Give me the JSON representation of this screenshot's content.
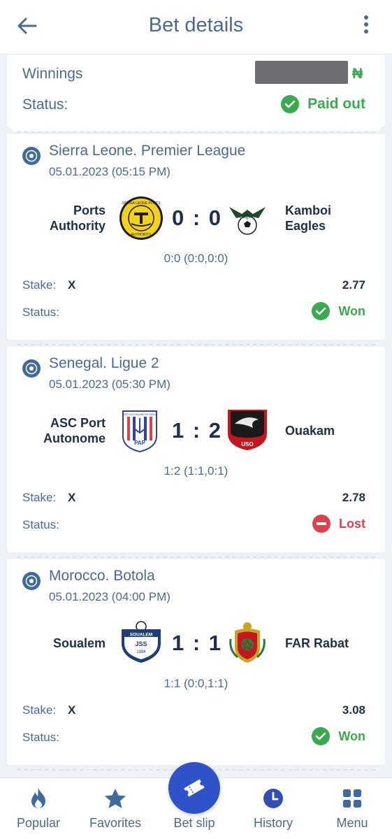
{
  "header": {
    "title": "Bet details"
  },
  "summary": {
    "winnings_label": "Winnings",
    "currency_symbol": "₦",
    "status_label": "Status:",
    "status_value": "Paid out"
  },
  "matches": [
    {
      "league": "Sierra Leone. Premier League",
      "date": "05.01.2023 (05:15 PM)",
      "home_line1": "Ports",
      "home_line2": "Authority",
      "away_line1": "Kamboi",
      "away_line2": "Eagles",
      "score": "0 : 0",
      "score_detail": "0:0 (0:0,0:0)",
      "stake_label": "Stake:",
      "stake_value": "X",
      "odds": "2.77",
      "status_label": "Status:",
      "status": "Won"
    },
    {
      "league": "Senegal. Ligue 2",
      "date": "05.01.2023 (05:30 PM)",
      "home_line1": "ASC Port",
      "home_line2": "Autonome",
      "away_line1": "Ouakam",
      "away_line2": "",
      "score": "1 : 2",
      "score_detail": "1:2 (1:1,0:1)",
      "stake_label": "Stake:",
      "stake_value": "X",
      "odds": "2.78",
      "status_label": "Status:",
      "status": "Lost"
    },
    {
      "league": "Morocco. Botola",
      "date": "05.01.2023 (04:00 PM)",
      "home_line1": "Soualem",
      "home_line2": "",
      "away_line1": "FAR Rabat",
      "away_line2": "",
      "score": "1 : 1",
      "score_detail": "1:1 (0:0,1:1)",
      "stake_label": "Stake:",
      "stake_value": "X",
      "odds": "3.08",
      "status_label": "Status:",
      "status": "Won"
    }
  ],
  "logos": {
    "ports_authority": "SIERRA LEONE PORTS",
    "ports_authority_bottom": "AUTHORITY",
    "kamboi": "Eagles",
    "asc_port": "PORT AUTONOME DE DAKAR",
    "asc_port_abbr": "PAP",
    "ouakam": "USO",
    "soualem_top": "SOUALEM",
    "soualem_mid": "JSS",
    "soualem_year": "1984"
  },
  "nav": {
    "popular": "Popular",
    "favorites": "Favorites",
    "betslip": "Bet slip",
    "history": "History",
    "menu": "Menu"
  },
  "colors": {
    "primary_text": "#4b6a92",
    "dark_text": "#1f2f49",
    "won_green": "#3aaa4f",
    "lost_red": "#d9434b",
    "active_blue": "#2f50b0"
  }
}
